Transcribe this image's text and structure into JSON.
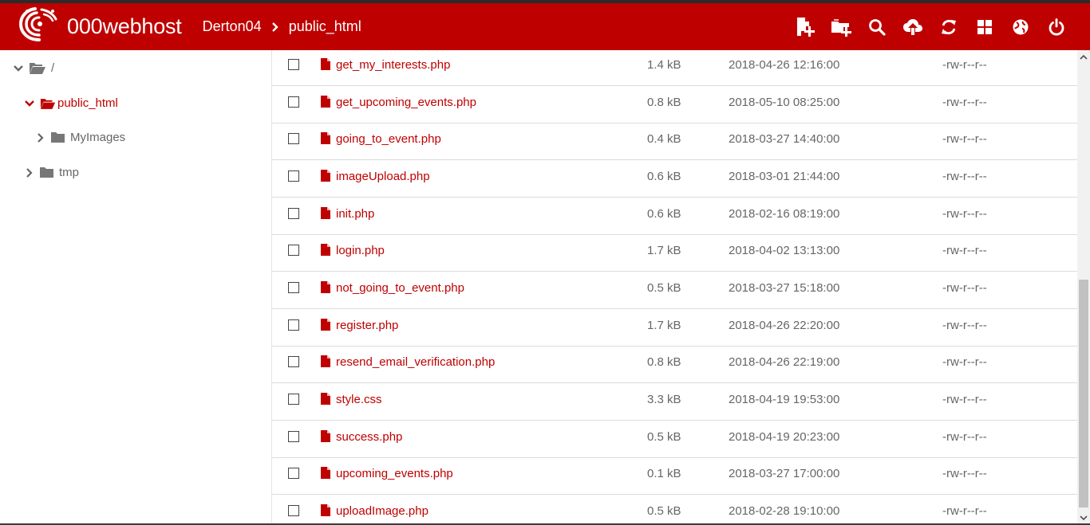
{
  "header": {
    "logo_text": "000webhost",
    "breadcrumb": [
      "Derton04",
      "public_html"
    ],
    "toolbar": [
      {
        "name": "new-file-icon"
      },
      {
        "name": "new-folder-icon"
      },
      {
        "name": "search-icon"
      },
      {
        "name": "upload-icon"
      },
      {
        "name": "refresh-icon"
      },
      {
        "name": "view-grid-icon"
      },
      {
        "name": "globe-icon"
      },
      {
        "name": "power-icon"
      }
    ]
  },
  "tree": [
    {
      "label": "/",
      "expanded": true,
      "icon": "folder-open-icon"
    },
    {
      "label": "public_html",
      "expanded": true,
      "active": true,
      "icon": "folder-open-icon"
    },
    {
      "label": "MyImages",
      "expanded": false,
      "icon": "folder-icon"
    },
    {
      "label": "tmp",
      "expanded": false,
      "icon": "folder-icon"
    }
  ],
  "files": [
    {
      "name": "get_my_interests.php",
      "size": "1.4 kB",
      "date": "2018-04-26 12:16:00",
      "perms": "-rw-r--r--"
    },
    {
      "name": "get_upcoming_events.php",
      "size": "0.8 kB",
      "date": "2018-05-10 08:25:00",
      "perms": "-rw-r--r--"
    },
    {
      "name": "going_to_event.php",
      "size": "0.4 kB",
      "date": "2018-03-27 14:40:00",
      "perms": "-rw-r--r--"
    },
    {
      "name": "imageUpload.php",
      "size": "0.6 kB",
      "date": "2018-03-01 21:44:00",
      "perms": "-rw-r--r--"
    },
    {
      "name": "init.php",
      "size": "0.6 kB",
      "date": "2018-02-16 08:19:00",
      "perms": "-rw-r--r--"
    },
    {
      "name": "login.php",
      "size": "1.7 kB",
      "date": "2018-04-02 13:13:00",
      "perms": "-rw-r--r--"
    },
    {
      "name": "not_going_to_event.php",
      "size": "0.5 kB",
      "date": "2018-03-27 15:18:00",
      "perms": "-rw-r--r--"
    },
    {
      "name": "register.php",
      "size": "1.7 kB",
      "date": "2018-04-26 22:20:00",
      "perms": "-rw-r--r--"
    },
    {
      "name": "resend_email_verification.php",
      "size": "0.8 kB",
      "date": "2018-04-26 22:19:00",
      "perms": "-rw-r--r--"
    },
    {
      "name": "style.css",
      "size": "3.3 kB",
      "date": "2018-04-19 19:53:00",
      "perms": "-rw-r--r--"
    },
    {
      "name": "success.php",
      "size": "0.5 kB",
      "date": "2018-04-19 20:23:00",
      "perms": "-rw-r--r--"
    },
    {
      "name": "upcoming_events.php",
      "size": "0.1 kB",
      "date": "2018-03-27 17:00:00",
      "perms": "-rw-r--r--"
    },
    {
      "name": "uploadImage.php",
      "size": "0.5 kB",
      "date": "2018-02-28 19:10:00",
      "perms": "-rw-r--r--"
    }
  ],
  "colors": {
    "brand": "#bf0000",
    "text": "#666666"
  }
}
